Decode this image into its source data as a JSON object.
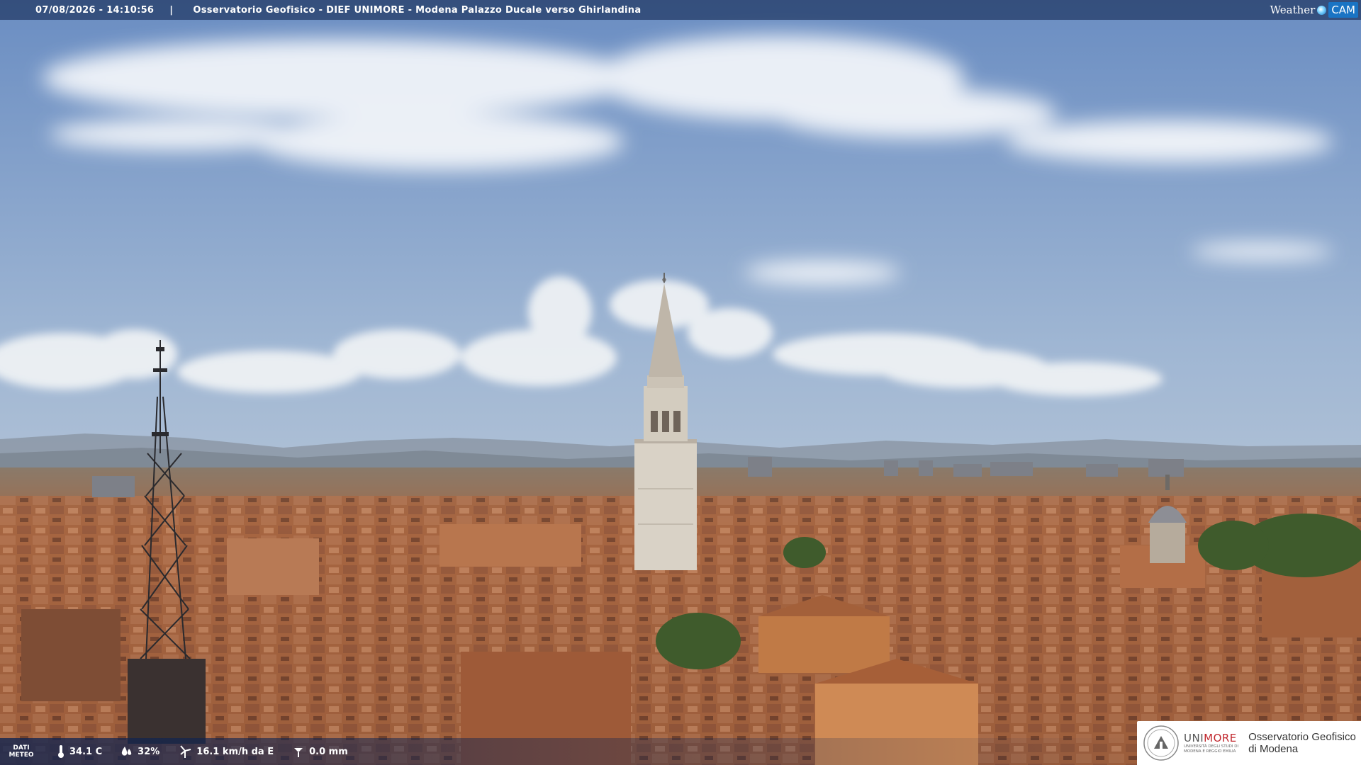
{
  "banner": {
    "timestamp": "07/08/2026 - 14:10:56",
    "separator": "|",
    "title": "Osservatorio Geofisico - DIEF UNIMORE - Modena Palazzo Ducale verso Ghirlandina"
  },
  "brand": {
    "weather": "Weather",
    "cam": "CAM",
    "icon": "globe-dot-icon"
  },
  "weather_bar": {
    "label_line1": "DATI",
    "label_line2": "METEO",
    "temperature": "34.1 C",
    "humidity": "32%",
    "wind": "16.1 km/h da E",
    "rain": "0.0 mm",
    "icons": [
      "thermometer-icon",
      "humidity-drop-icon",
      "wind-turbine-icon",
      "rain-gauge-icon"
    ]
  },
  "logo": {
    "uni_prefix": "UNI",
    "uni_suffix": "MORE",
    "uni_sub1": "UNIVERSITÀ DEGLI STUDI DI",
    "uni_sub2": "MODENA E REGGIO EMILIA",
    "obs_line1": "Osservatorio Geofisico",
    "obs_line2": "di Modena",
    "accent": "#c1272d"
  },
  "scene": {
    "sky_top": "#6f92c6",
    "sky_horizon": "#c9d3de",
    "roof_color": "#a4623e",
    "tower_color": "#d9d2c6",
    "tree_color": "#3c5a2a"
  }
}
